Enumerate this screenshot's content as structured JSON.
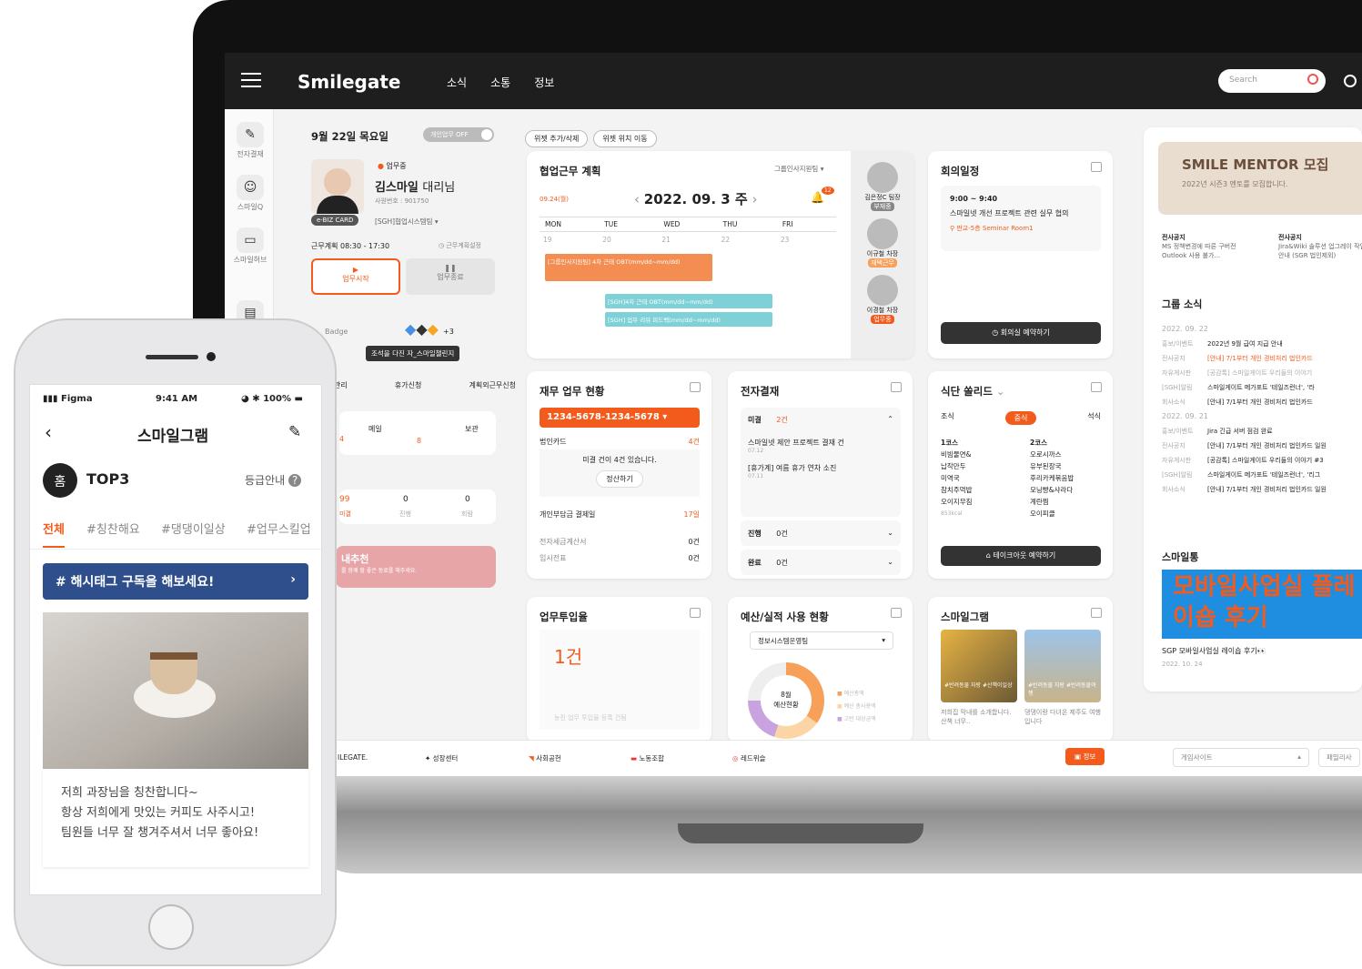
{
  "nav": {
    "brand": "Smilegate",
    "items": [
      "소식",
      "소통",
      "정보"
    ],
    "search_placeholder": "Search"
  },
  "leftbar": [
    "전자결재",
    "스마일Q",
    "스마일허브"
  ],
  "profile": {
    "date": "9월 22일 목요일",
    "toggle": "개인업무 OFF",
    "status": "업무중",
    "name": "김스마일",
    "title": "대리님",
    "empno": "사원번호 : 901750",
    "card": "e-BIZ CARD",
    "dept": "[SGH]협업시스템팀",
    "plan": "근무계획 08:30 - 17:30",
    "plan_setting": "근무계획설정",
    "start": "업무시작",
    "end": "업무종료",
    "badge": "Badge",
    "badge_more": "+3",
    "tooltip": "조석을 다진 자_스마일챌린지",
    "links": [
      "관리",
      "휴가신청",
      "계획외근무신청"
    ],
    "mail": "메일",
    "mail_count": "4",
    "print": "8",
    "keep": "보관",
    "stats": [
      {
        "v": "99",
        "l": "미결"
      },
      {
        "v": "0",
        "l": "진행"
      },
      {
        "v": "0",
        "l": "회람"
      }
    ],
    "recommend": "내추천",
    "recommend_desc": "를 함께 할 좋은 동료를 해주세요."
  },
  "widget_chips": [
    "위젯 추가/삭제",
    "위젯 위치 이동"
  ],
  "cowork": {
    "title": "협업근무 계획",
    "filter": "그룹인사지원팀",
    "date": "2022. 09. 3 주",
    "today": "09.24(월)",
    "notif": "12",
    "days": [
      "MON",
      "TUE",
      "WED",
      "THU",
      "FRI"
    ],
    "nums": [
      "19",
      "20",
      "21",
      "22",
      "23"
    ],
    "event1": "[그룹인사지원팀] 4차 근태 OBT(mm/dd~mm/dd)",
    "event2": "[SGH]4차 근태 OBT(mm/dd~mm/dd)",
    "event3": "[SGH] 업무 리뷰 피드백(mm/dd~mm/dd)",
    "people": [
      {
        "n": "김은정C 팀장",
        "s": "부재중"
      },
      {
        "n": "이규철 차장",
        "s": "재택근무"
      },
      {
        "n": "이경철 차장",
        "s": "업무중"
      }
    ]
  },
  "meeting": {
    "title": "회의일정",
    "time": "9:00 ~ 9:40",
    "desc": "스마일넷 개선 프로젝트 관련 실무 협의",
    "place": "판교-5층 Seminar Room1",
    "btn": "회의실 예약하기"
  },
  "finance": {
    "title": "재무 업무 현황",
    "card": "1234-5678-1234-5678",
    "row1": "법인카드",
    "row1v": "4건",
    "msg": "미결 건이 4건 있습니다.",
    "btn": "정산하기",
    "row2": "개인부담금 결제일",
    "row2v": "17일",
    "row3": "전자세금계산서",
    "row3v": "0건",
    "row4": "임시전표",
    "row4v": "0건"
  },
  "approval": {
    "title": "전자결재",
    "g1": "미결",
    "g1v": "2건",
    "i1": "스마일넷 제안 프로젝트 결재 건",
    "d1": "07.12",
    "i2": "[휴가계] 여름 휴가 연차 소진",
    "d2": "07.11",
    "g2": "진행",
    "g2v": "0건",
    "g3": "완료",
    "g3v": "0건"
  },
  "menu": {
    "title": "식단 쏠리드",
    "tabs": [
      "조식",
      "중식",
      "석식"
    ],
    "c1": "1코스",
    "c1items": [
      "비빔물면&",
      "납작만두",
      "미역국",
      "참치주먹밥",
      "오이지무침"
    ],
    "kcal": "853kcal",
    "c2": "2코스",
    "c2items": [
      "오로시까스",
      "유부된장국",
      "후리카케볶음밥",
      "모닝빵&샤라다",
      "계란찜",
      "오이피클"
    ],
    "btn": "테이크아웃 예약하기"
  },
  "input": {
    "title": "업무투입율",
    "value": "1건",
    "hint": "농진 업무 투입율 등록 건됨"
  },
  "budget": {
    "title": "예산/실적 사용 현황",
    "select": "정보시스템운영팀",
    "center": "8월\n예산현황",
    "legend": [
      "예산총액",
      "예산 총사용액",
      "고반 대상금액"
    ]
  },
  "smilegram": {
    "title": "스마일그램",
    "t1": "#반려동물 자랑 #산책이일상",
    "d1": "저희집 막내를 소개합니다. 산책 너무..",
    "t2": "#반려동물 자랑 #반려동물여행",
    "d2": "댕댕이랑 다녀온 제주도 여행입니다"
  },
  "right": {
    "mentor": "SMILE MENTOR 모집",
    "mentor_sub": "2022년 시즌3 멘토를 모집합니다.",
    "n1t": "전사공지",
    "n1": "MS 정책변경에 따른 구버전 Outlook 사용 불가...",
    "n2t": "전사공지",
    "n2": "Jira&Wiki 솔루션 업그레이 작업 안내 (SGR 법인제외)",
    "group": "그룹 소식",
    "d1": "2022. 09. 22",
    "news1": [
      [
        "홍보/이벤트",
        "2022년 9월 급여 지급 안내"
      ],
      [
        "전사공지",
        "[안내] 7/1부터 개인 경비처리 법인카드"
      ],
      [
        "자유게시판",
        "[공감톡] 스마일게이트 우리들의 이야기"
      ],
      [
        "[SGH]알림",
        "스마일게이트 메가포트 '테일즈런너', '라"
      ],
      [
        "회사소식",
        "[안내] 7/1부터 개인 경비처리 법인카드"
      ]
    ],
    "d2": "2022. 09. 21",
    "news2": [
      [
        "홍보/이벤트",
        "Jira 긴급 서버 점검 완료"
      ],
      [
        "전사공지",
        "[안내] 7/1부터 개인 경비처리 법인카드 일원"
      ],
      [
        "자유게시판",
        "[공감톡] 스마일게이트 우리들의 이야기 #3"
      ],
      [
        "[SGH]알림",
        "스마일게이트 메가포트 '테일즈런너', '리그"
      ],
      [
        "회사소식",
        "[안내] 7/1부터 개인 경비처리 법인카드 일원"
      ]
    ],
    "smiledong": "스마일통",
    "banner": "모바일사업실 플레이숍 후기",
    "banner_t": "SGP 모바일사업실 레이숍 후기👀",
    "banner_d": "2022. 10. 24"
  },
  "footer": {
    "items": [
      "ILEGATE.",
      "성장센터",
      "사회공헌",
      "노동조합",
      "레드위슬"
    ],
    "info": "정보",
    "game": "게임사이트",
    "more": "패밀리사"
  },
  "phone": {
    "carrier": "Figma",
    "time": "9:41 AM",
    "battery": "100%",
    "title": "스마일그램",
    "home": "홈",
    "top": "TOP3",
    "grade": "등급안내",
    "tags": [
      "전체",
      "#칭찬해요",
      "#댕댕이일상",
      "#업무스킬업"
    ],
    "banner": "# 해시태그 구독을 해보세요!",
    "post": "저희 과장님을 칭찬합니다~\n항상 저희에게 맛있는 커피도 사주시고!\n팀원들 너무 잘 챙겨주셔서 너무 좋아요!"
  }
}
